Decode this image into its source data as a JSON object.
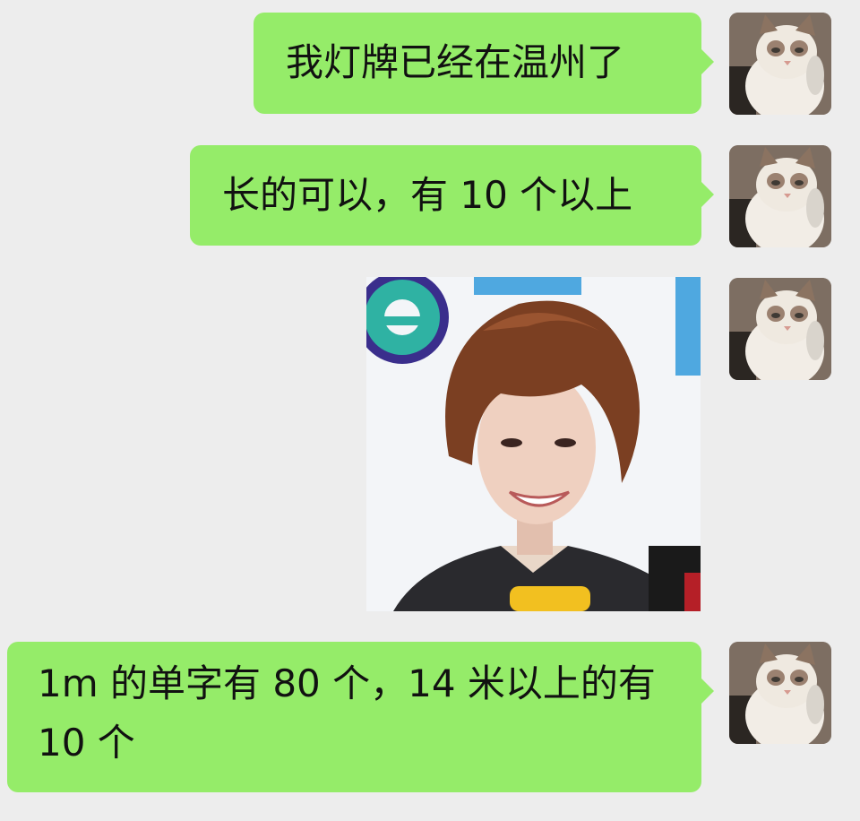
{
  "messages": [
    {
      "sender": "self",
      "type": "text",
      "text": "我灯牌已经在温州了"
    },
    {
      "sender": "self",
      "type": "text",
      "text": "长的可以，有 10 个以上"
    },
    {
      "sender": "self",
      "type": "image",
      "content": "photo of a smiling person with short brown hair"
    },
    {
      "sender": "self",
      "type": "text",
      "text": "1m 的单字有 80 个，14 米以上的有10 个"
    }
  ],
  "colors": {
    "background": "#ededed",
    "bubble": "#95ec69",
    "text": "#111111"
  },
  "avatar": {
    "icon": "cat-avatar-icon"
  }
}
